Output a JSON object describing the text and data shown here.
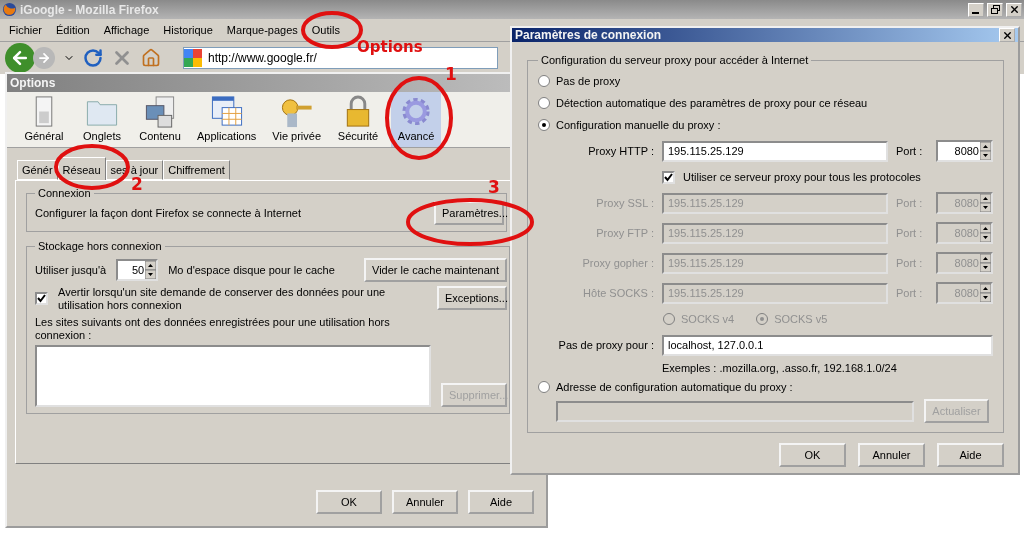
{
  "browser": {
    "title": "iGoogle - Mozilla Firefox",
    "menu": [
      "Fichier",
      "Édition",
      "Affichage",
      "Historique",
      "Marque-pages",
      "Outils"
    ],
    "url": "http://www.google.fr/"
  },
  "options": {
    "title": "Options",
    "panes": [
      {
        "kind": "general",
        "label": "Général",
        "selected": false
      },
      {
        "kind": "tabs",
        "label": "Onglets",
        "selected": false
      },
      {
        "kind": "content",
        "label": "Contenu",
        "selected": false
      },
      {
        "kind": "applications",
        "label": "Applications",
        "selected": false
      },
      {
        "kind": "privacy",
        "label": "Vie privée",
        "selected": false
      },
      {
        "kind": "security",
        "label": "Sécurité",
        "selected": false
      },
      {
        "kind": "advanced",
        "label": "Avancé",
        "selected": true
      }
    ],
    "tabs": [
      {
        "label": "Génér",
        "selected": false
      },
      {
        "label": "Réseau",
        "selected": true
      },
      {
        "label": "ses à jour",
        "selected": false
      },
      {
        "label": "Chiffrement",
        "selected": false
      }
    ],
    "connection": {
      "legend": "Connexion",
      "text": "Configurer la façon dont Firefox se connecte à Internet",
      "button": "Paramètres..."
    },
    "storage": {
      "legend": "Stockage hors connexion",
      "cache_prefix": "Utiliser jusqu'à",
      "cache_value": "50",
      "cache_suffix": "Mo d'espace disque pour le cache",
      "clear_button": "Vider le cache maintenant",
      "warn": {
        "label": "Avertir lorsqu'un site demande de conserver des données pour une utilisation hors connexion",
        "checked": true
      },
      "exceptions_button": "Exceptions...",
      "sites_label": "Les sites suivants ont des données enregistrées pour une utilisation hors connexion :",
      "remove_button": {
        "label": "Supprimer...",
        "disabled": true
      }
    },
    "buttons": [
      "OK",
      "Annuler",
      "Aide"
    ]
  },
  "connection_dialog": {
    "title": "Paramètres de connexion",
    "legend": "Configuration du serveur proxy pour accéder à Internet",
    "modes": [
      {
        "label": "Pas de proxy",
        "selected": false
      },
      {
        "label": "Détection automatique des paramètres de proxy pour ce réseau",
        "selected": false
      },
      {
        "label": "Configuration manuelle du proxy :",
        "selected": true
      }
    ],
    "proxies": [
      {
        "label": "Proxy HTTP :",
        "value": "195.115.25.129",
        "port_label": "Port :",
        "port": "8080",
        "disabled": false
      },
      {
        "label": "Proxy SSL :",
        "value": "195.115.25.129",
        "port_label": "Port :",
        "port": "8080",
        "disabled": true
      },
      {
        "label": "Proxy FTP :",
        "value": "195.115.25.129",
        "port_label": "Port :",
        "port": "8080",
        "disabled": true
      },
      {
        "label": "Proxy gopher :",
        "value": "195.115.25.129",
        "port_label": "Port :",
        "port": "8080",
        "disabled": true
      },
      {
        "label": "Hôte SOCKS :",
        "value": "195.115.25.129",
        "port_label": "Port :",
        "port": "8080",
        "disabled": true
      }
    ],
    "share": {
      "label": "Utiliser ce serveur proxy pour tous les protocoles",
      "checked": true
    },
    "socks_disabled": true,
    "socks_versions": [
      {
        "label": "SOCKS v4",
        "selected": false
      },
      {
        "label": "SOCKS v5",
        "selected": true
      }
    ],
    "no_proxy_label": "Pas de proxy pour :",
    "no_proxy_value": "localhost, 127.0.0.1",
    "examples": "Exemples : .mozilla.org, .asso.fr, 192.168.1.0/24",
    "auto_config": {
      "label": "Adresse de configuration automatique du proxy :",
      "selected": false
    },
    "reload_button": {
      "label": "Actualiser",
      "disabled": true
    },
    "buttons": [
      "OK",
      "Annuler",
      "Aide"
    ]
  },
  "annotations": {
    "menu_label": "Options",
    "step_1": "1",
    "step_2": "2",
    "step_3": "3"
  }
}
